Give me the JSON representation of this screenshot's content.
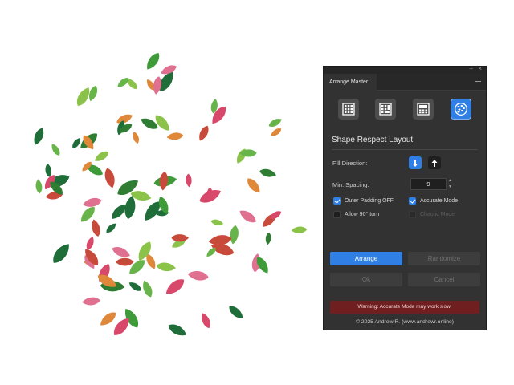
{
  "colors": {
    "panel_bg": "#323232",
    "accent": "#2f7fe4",
    "warning_bg": "#6f1f1f",
    "leaf_green": "#2e8b3a",
    "leaf_pink": "#d8486a",
    "leaf_orange": "#e0883a"
  },
  "window_controls": {
    "minimize": "–",
    "close": "×"
  },
  "panel": {
    "tab_title": "Arrange Master",
    "menu_icon": "hamburger-icon"
  },
  "modes": [
    {
      "name": "grid-3x3-icon",
      "active": false
    },
    {
      "name": "grid-panel-icon",
      "active": false
    },
    {
      "name": "grid-highlight-icon",
      "active": false
    },
    {
      "name": "shape-layout-icon",
      "active": true
    }
  ],
  "layout_title": "Shape Respect Layout",
  "fill_direction": {
    "label": "Fill Direction:",
    "down_icon": "arrow-down-icon",
    "up_icon": "arrow-up-icon",
    "selected": "down"
  },
  "min_spacing": {
    "label": "Min. Spacing:",
    "value": "9",
    "up": "▲",
    "down": "▼"
  },
  "options": {
    "outer_padding": {
      "label": "Outer Padding OFF",
      "checked": true
    },
    "accurate_mode": {
      "label": "Accurate Mode",
      "checked": true
    },
    "allow_90": {
      "label": "Allow 90° turn",
      "checked": false
    },
    "chaotic_mode": {
      "label": "Chaotic Mode",
      "checked": false,
      "disabled": true
    }
  },
  "buttons": {
    "arrange": "Arrange",
    "randomize": "Randomize",
    "ok": "Ok",
    "cancel": "Cancel"
  },
  "warning": "Warning: Accurate Mode may work slow!",
  "footer": "© 2025 Andrew R. (www.andrewr.online)"
}
